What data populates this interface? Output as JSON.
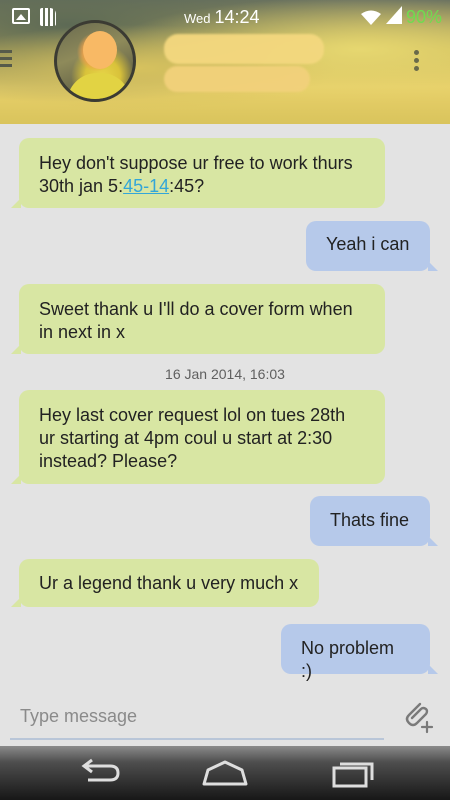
{
  "status_bar": {
    "day": "Wed",
    "time": "14:24",
    "battery": "90%",
    "battery_color": "#6fdc4f",
    "icons": [
      "gallery-icon",
      "sim-card-icon",
      "wifi-icon",
      "signal-icon"
    ]
  },
  "header": {
    "menu_icon": "hamburger-icon",
    "overflow_icon": "overflow-menu-icon",
    "avatar": "contact-avatar"
  },
  "colors": {
    "incoming_bubble": "#d8e6a3",
    "outgoing_bubble": "#b6c9ea",
    "link": "#33a6d8",
    "background": "#e3e3e3"
  },
  "messages": [
    {
      "direction": "in",
      "text_before": "Hey don't suppose ur free to work thurs 30th jan 5:",
      "link": "45-14",
      "text_after": ":45?"
    },
    {
      "direction": "out",
      "text": "Yeah i can"
    },
    {
      "direction": "in",
      "text": "Sweet thank u I'll do a cover form when in next in x"
    },
    {
      "direction": "in",
      "text": "Hey last cover request lol on tues 28th ur starting at 4pm coul u start at 2:30 instead? Please?"
    },
    {
      "direction": "out",
      "text": "Thats fine"
    },
    {
      "direction": "in",
      "text": "Ur a legend thank u very much x"
    },
    {
      "direction": "out",
      "text": "No problem :)"
    }
  ],
  "timestamp": "16 Jan 2014, 16:03",
  "composer": {
    "placeholder": "Type message",
    "value": "",
    "attach_icon": "paperclip-add-icon"
  },
  "nav_bar": {
    "icons": [
      "back-icon",
      "home-icon",
      "recent-apps-icon"
    ]
  }
}
